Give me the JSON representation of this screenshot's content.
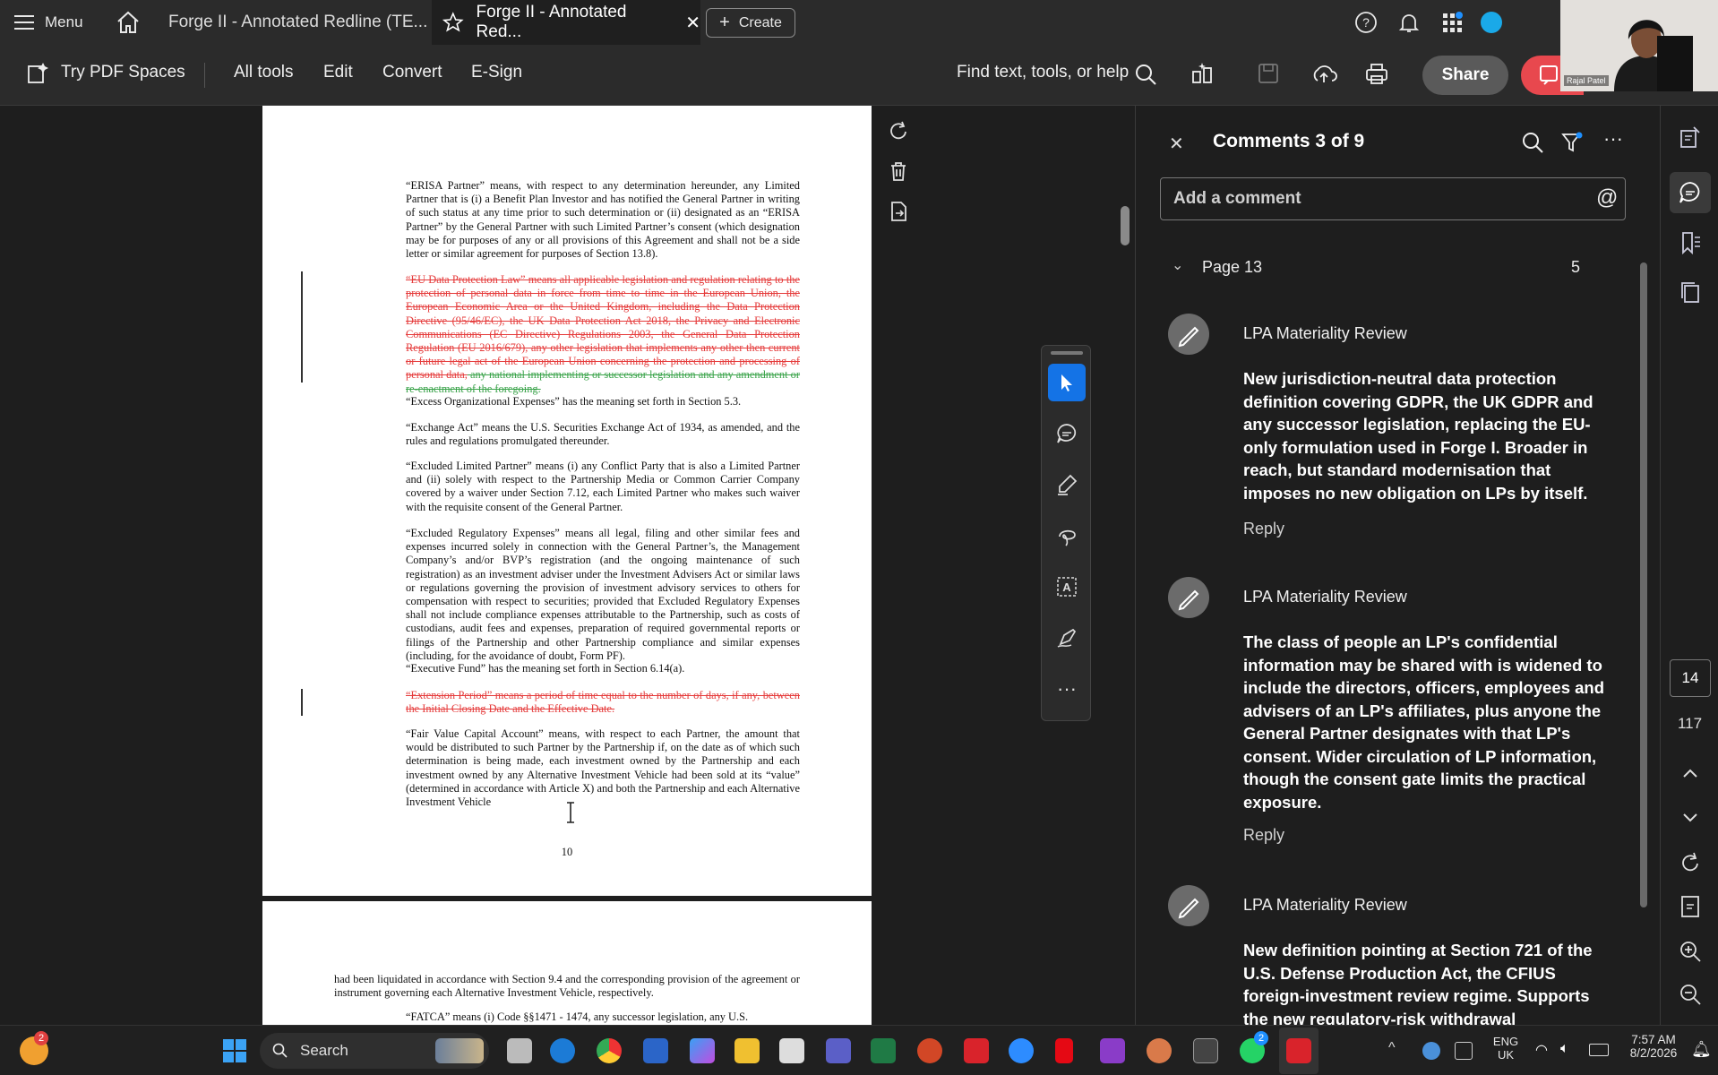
{
  "titlebar": {
    "menu_label": "Menu",
    "tab1_label": "Forge II - Annotated Redline (TE...",
    "tab2_label": "Forge II - Annotated Red...",
    "create_label": "Create"
  },
  "toolbar": {
    "try_pdf_spaces": "Try PDF Spaces",
    "all_tools": "All tools",
    "edit": "Edit",
    "convert": "Convert",
    "esign": "E-Sign",
    "find": "Find text, tools, or help",
    "share": "Share",
    "webcam_name": "Rajal Patel"
  },
  "document": {
    "p_erisa": "“ERISA Partner” means, with respect to any determination hereunder, any Limited Partner that is (i) a Benefit Plan Investor and has notified the General Partner in writing of such status at any time prior to such determination or (ii) designated as an “ERISA Partner” by the General Partner with such Limited Partner’s consent (which designation may be for purposes of any or all provisions of this Agreement and shall not be a side letter or similar agreement for purposes of Section 13.8).",
    "p_eu_red": "“EU Data Protection Law” means all applicable legislation and regulation relating to the protection of personal data in force from time to time in the European Union, the European Economic Area or the United Kingdom, including the Data Protection Directive (95/46/EC), the UK Data Protection Act 2018, the Privacy and Electronic Communications (EC Directive) Regulations 2003, the General Data Protection Regulation (EU 2016/679), any other legislation that implements any other then current or future legal act of the European Union concerning the protection and processing of personal data,",
    "p_eu_green": " any national implementing or successor legislation and any amendment or re-enactment of the foregoing.",
    "p_excess": "“Excess Organizational Expenses” has the meaning set forth in Section 5.3.",
    "p_exchange": "“Exchange Act” means the U.S. Securities Exchange Act of 1934, as amended, and the rules and regulations promulgated thereunder.",
    "p_excluded_lp": "“Excluded Limited Partner” means (i) any Conflict Party that is also a Limited Partner and (ii) solely with respect to the Partnership Media or Common Carrier Company covered by a waiver under Section 7.12, each Limited Partner who makes such waiver with the requisite consent of the General Partner.",
    "p_excluded_reg": "“Excluded Regulatory Expenses” means all legal, filing and other similar fees and expenses incurred solely in connection with the General Partner’s, the Management Company’s and/or BVP’s registration (and the ongoing maintenance of such registration) as an investment adviser under the Investment Advisers Act or similar laws or regulations governing the provision of investment advisory services to others for compensation with respect to securities; provided that Excluded Regulatory Expenses shall not include compliance expenses attributable to the Partnership, such as costs of custodians, audit fees and expenses, preparation of required governmental reports or filings of the Partnership and other Partnership compliance and similar expenses (including, for the avoidance of doubt, Form PF).",
    "p_executive": "“Executive Fund” has the meaning set forth in Section 6.14(a).",
    "p_extension_red": "“Extension Period” means a period of time equal to the number of days, if any, between the Initial Closing Date and the Effective Date.",
    "p_fair_value": "“Fair Value Capital Account” means, with respect to each Partner, the amount that would be distributed to such Partner by the Partnership if, on the date as of which such determination is being made, each investment owned by the Partnership and each investment owned by any Alternative Investment Vehicle had been sold at its “value” (determined in accordance with Article X) and both the Partnership and each Alternative Investment Vehicle",
    "page_number": "10",
    "p2_liquidated": "had been liquidated in accordance with Section 9.4 and the corresponding provision of the agreement or instrument governing each Alternative Investment Vehicle, respectively.",
    "p2_fatca": "“FATCA” means (i) Code §§1471 - 1474, any successor legislation, any U.S."
  },
  "comments": {
    "title": "Comments 3 of 9",
    "add_placeholder": "Add a comment",
    "page_label": "Page 13",
    "page_count": "5",
    "items": [
      {
        "author": "LPA Materiality Review",
        "body": "New jurisdiction-neutral data protection definition covering GDPR, the UK GDPR and any successor legislation, replacing the EU-only formulation used in Forge I. Broader in reach, but standard modernisation that imposes no new obligation on LPs by itself.",
        "reply": "Reply"
      },
      {
        "author": "LPA Materiality Review",
        "body": "The class of people an LP's confidential information may be shared with is widened to include the directors, officers, employees and advisers of an LP's affiliates, plus anyone the General Partner designates with that LP's consent. Wider circulation of LP information, though the consent gate limits the practical exposure.",
        "reply": "Reply"
      },
      {
        "author": "LPA Materiality Review",
        "body": "New definition pointing at Section 721 of the U.S. Defense Production Act, the CFIUS foreign-investment review regime. Supports the new regulatory-risk withdrawal",
        "reply": ""
      }
    ]
  },
  "rail": {
    "current_page": "14",
    "total_pages": "117"
  },
  "taskbar": {
    "search": "Search",
    "lang1": "ENG",
    "lang2": "UK",
    "time": "7:57 AM",
    "date": "8/2/2026",
    "copilot_badge": "2",
    "whatsapp_badge": "2"
  },
  "colors": {
    "accent_blue": "#1473e6",
    "deletion_red": "#e53b3b",
    "deletion_green": "#3aa34a",
    "share_bg": "#5a5a5a",
    "adobe_red": "#e8484e"
  }
}
